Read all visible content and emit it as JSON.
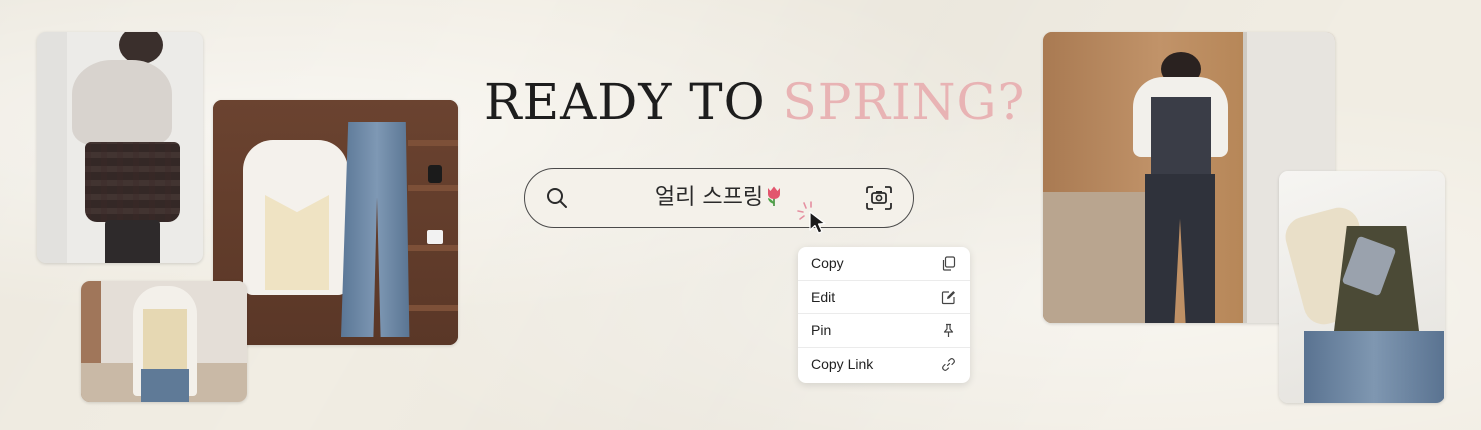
{
  "banner": {
    "title_part1": "READY TO ",
    "title_part2": "SPRING?",
    "title_accent_color": "#e8b3b4",
    "background_color": "#f1ede3"
  },
  "search": {
    "query": "얼리 스프링",
    "emoji": "tulip",
    "left_icon": "search-icon",
    "right_icon": "camera-scan-icon"
  },
  "context_menu": {
    "items": [
      {
        "label": "Copy",
        "icon": "copy-icon"
      },
      {
        "label": "Edit",
        "icon": "edit-icon"
      },
      {
        "label": "Pin",
        "icon": "pin-icon"
      },
      {
        "label": "Copy Link",
        "icon": "link-icon"
      }
    ]
  },
  "photos": [
    {
      "name": "outfit-photo-plaid-skirt"
    },
    {
      "name": "outfit-photo-flatlay-blouse-jeans"
    },
    {
      "name": "outfit-photo-cami-jeans"
    },
    {
      "name": "outfit-photo-mirror-selfie"
    },
    {
      "name": "outfit-photo-flatlay-khaki-cami"
    }
  ]
}
